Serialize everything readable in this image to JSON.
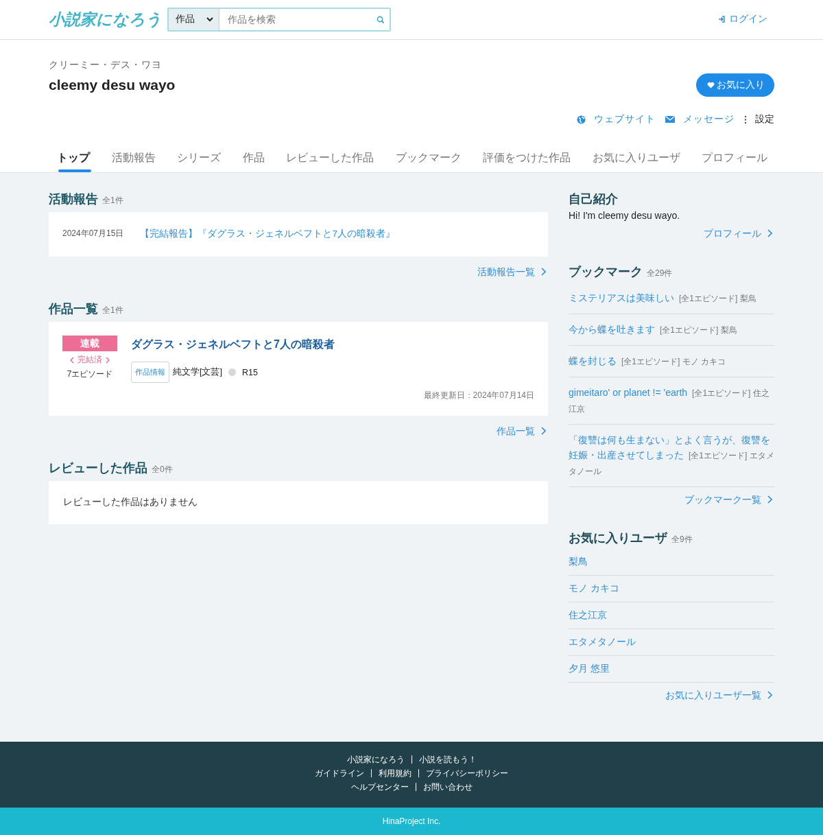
{
  "header": {
    "logo": "小説家になろう",
    "search_scope": "作品",
    "search": {
      "placeholder": "作品を検索"
    },
    "login": "ログイン"
  },
  "user": {
    "reading": "クリーミー・デス・ワヨ",
    "name": "cleemy desu wayo",
    "favorite_button": "お気に入り",
    "links": [
      {
        "kind": "website",
        "label": "ウェブサイト"
      },
      {
        "kind": "message",
        "label": "メッセージ"
      },
      {
        "kind": "settings",
        "label": "設定"
      }
    ]
  },
  "tabs": [
    {
      "label": "トップ",
      "selected": true
    },
    {
      "label": "活動報告",
      "selected": false
    },
    {
      "label": "シリーズ",
      "selected": false
    },
    {
      "label": "作品",
      "selected": false
    },
    {
      "label": "レビューした作品",
      "selected": false
    },
    {
      "label": "ブックマーク",
      "selected": false
    },
    {
      "label": "評価をつけた作品",
      "selected": false
    },
    {
      "label": "お気に入りユーザ",
      "selected": false
    },
    {
      "label": "プロフィール",
      "selected": false
    }
  ],
  "activity": {
    "title": "活動報告",
    "count": "全1件",
    "items": [
      {
        "date": "2024年07月15日",
        "title": "【完結報告】『ダグラス・ジェネルベフトと7人の暗殺者』"
      }
    ],
    "more": "活動報告一覧"
  },
  "works": {
    "title": "作品一覧",
    "count": "全1件",
    "items": [
      {
        "type": "連載",
        "status": "完結済",
        "episodes": "7エピソード",
        "title": "ダグラス・ジェネルベフトと7人の暗殺者",
        "info": "作品情報",
        "genre": "純文学[文芸]",
        "rating": "R15",
        "updated": "最終更新日：2024年07月14日"
      }
    ],
    "more": "作品一覧"
  },
  "reviews": {
    "title": "レビューした作品",
    "count": "全0件",
    "empty": "レビューした作品はありません"
  },
  "sidebar": {
    "intro": {
      "title": "自己紹介",
      "text": "Hi! I'm cleemy desu wayo.",
      "more": "プロフィール"
    },
    "bookmarks": {
      "title": "ブックマーク",
      "count": "全29件",
      "items": [
        {
          "title": "ミステリアスは美味しい",
          "meta": "[全1エピソード] 梨鳥"
        },
        {
          "title": "今から蝶を吐きます",
          "meta": "[全1エピソード] 梨鳥"
        },
        {
          "title": "蝶を封じる",
          "meta": "[全1エピソード] モノ カキコ"
        },
        {
          "title": "gimeitaro' or planet != 'earth",
          "meta": "[全1エピソード] 住之江京"
        },
        {
          "title": "「復讐は何も生まない」とよく言うが、復讐を妊娠・出産させてしまった",
          "meta": "[全1エピソード] エタメタノール"
        }
      ],
      "more": "ブックマーク一覧"
    },
    "favorite_users": {
      "title": "お気に入りユーザ",
      "count": "全9件",
      "items": [
        "梨鳥",
        "モノ カキコ",
        "住之江京",
        "エタメタノール",
        "夕月 悠里"
      ],
      "more": "お気に入りユーザ一覧"
    }
  },
  "footer": {
    "link_rows": [
      [
        "小説家になろう",
        "小説を読もう！"
      ],
      [
        "ガイドライン",
        "利用規約",
        "プライバシーポリシー"
      ],
      [
        "ヘルプセンター",
        "お問い合わせ"
      ]
    ],
    "copyright": "HinaProject Inc."
  }
}
